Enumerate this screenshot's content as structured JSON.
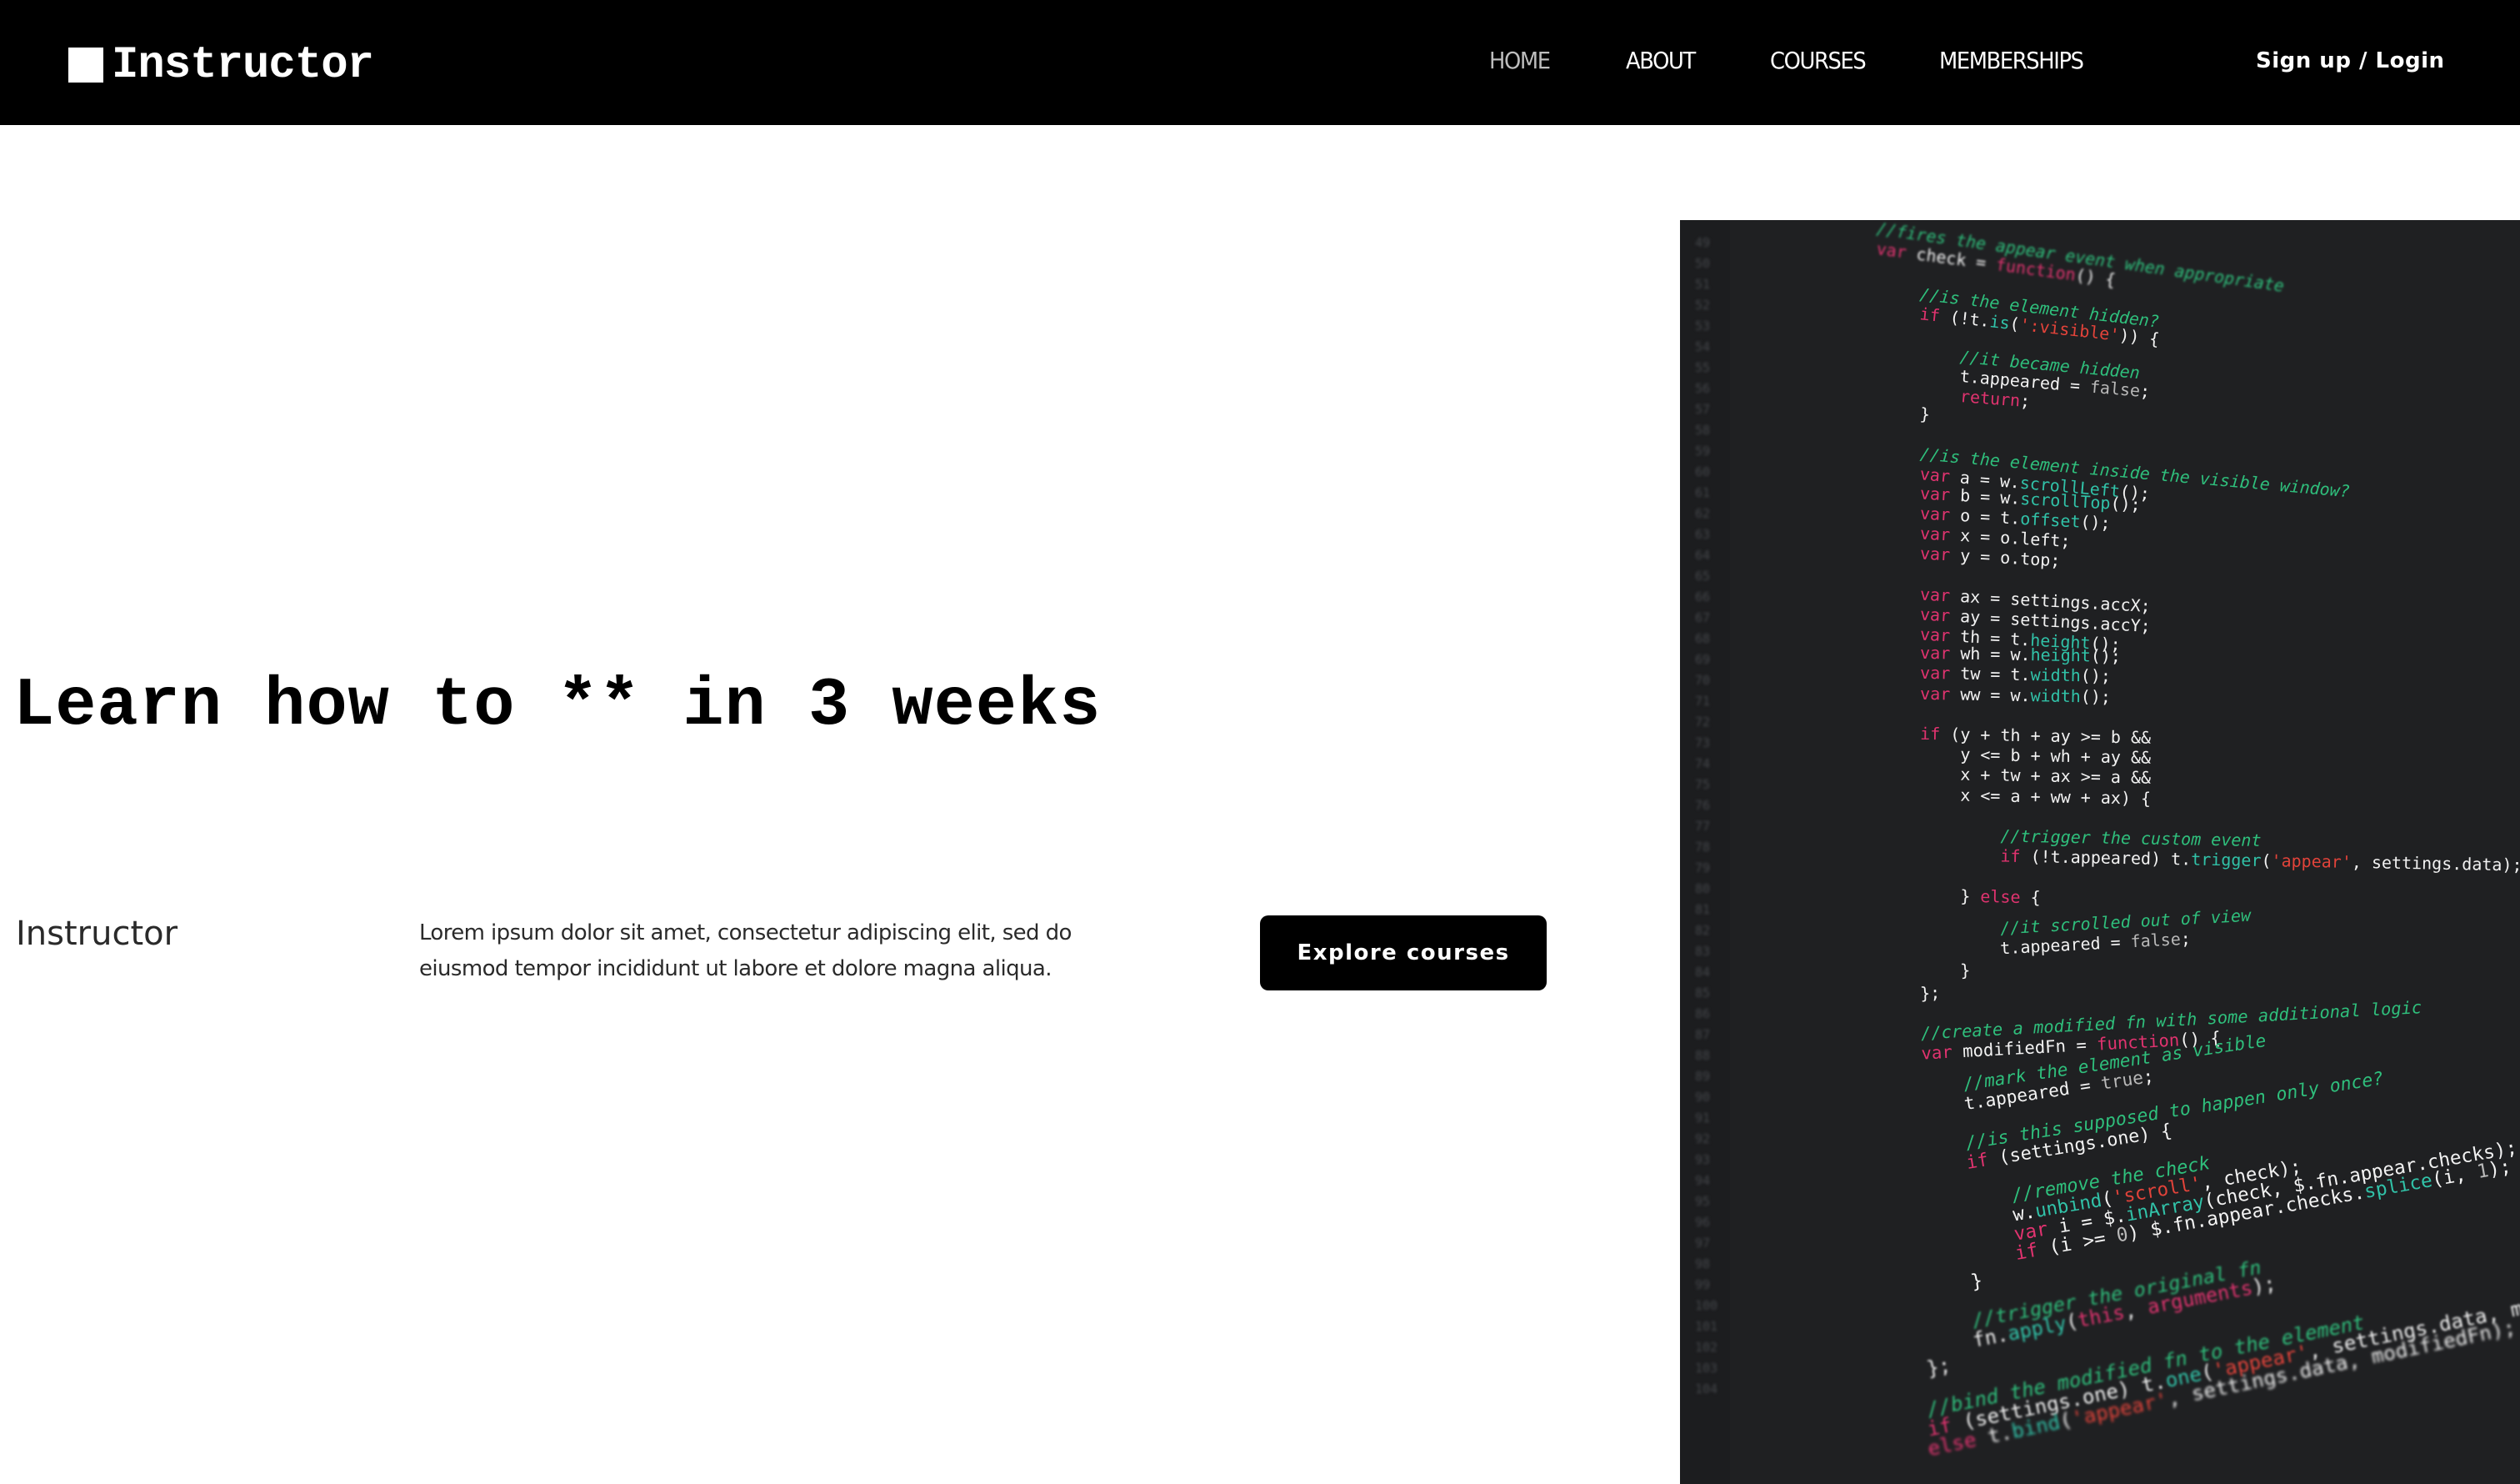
{
  "header": {
    "logo_text": "Instructor",
    "nav": [
      {
        "label": "HOME",
        "active": true
      },
      {
        "label": "ABOUT",
        "active": false
      },
      {
        "label": "COURSES",
        "active": false
      },
      {
        "label": "MEMBERSHIPS",
        "active": false
      }
    ],
    "signup_label": "Sign up / Login"
  },
  "hero": {
    "title": "Learn how to ** in 3 weeks",
    "brand_label": "Instructor",
    "description": "Lorem ipsum dolor sit amet, consectetur adipiscing elit, sed do eiusmod tempor incididunt ut labore et dolore magna aliqua.",
    "cta_label": "Explore courses"
  },
  "code_image": {
    "gutter_numbers": [
      "49",
      "50",
      "51",
      "52",
      "53",
      "54",
      "55",
      "56",
      "57",
      "58",
      "59",
      "60",
      "61",
      "62",
      "63",
      "64",
      "65",
      "66",
      "67",
      "68",
      "69",
      "70",
      "71",
      "72",
      "73",
      "74",
      "75",
      "76",
      "77",
      "78",
      "79",
      "80",
      "81",
      "82",
      "83",
      "84",
      "85",
      "86",
      "87",
      "88",
      "89",
      "90",
      "91",
      "92",
      "93",
      "94",
      "95",
      "96",
      "97",
      "98",
      "99",
      "100",
      "101",
      "102",
      "103",
      "104"
    ],
    "lines": [
      [
        {
          "t": "//fires the appear event when appropriate",
          "c": "cm"
        }
      ],
      [
        {
          "t": "var ",
          "c": "kw"
        },
        {
          "t": "check = "
        },
        {
          "t": "function",
          "c": "kw"
        },
        {
          "t": "() {"
        }
      ],
      [],
      [
        {
          "t": "    //is the element hidden?",
          "c": "cm"
        }
      ],
      [
        {
          "t": "    if ",
          "c": "kw"
        },
        {
          "t": "(!t."
        },
        {
          "t": "is",
          "c": "fn"
        },
        {
          "t": "("
        },
        {
          "t": "':visible'",
          "c": "str"
        },
        {
          "t": ")) {"
        }
      ],
      [],
      [
        {
          "t": "        //it became hidden",
          "c": "cm"
        }
      ],
      [
        {
          "t": "        t.appeared = "
        },
        {
          "t": "false",
          "c": "lit"
        },
        {
          "t": ";"
        }
      ],
      [
        {
          "t": "        return",
          "c": "kw"
        },
        {
          "t": ";"
        }
      ],
      [
        {
          "t": "    }"
        }
      ],
      [],
      [
        {
          "t": "    //is the element inside the visible window?",
          "c": "cm"
        }
      ],
      [
        {
          "t": "    var ",
          "c": "kw"
        },
        {
          "t": "a = w."
        },
        {
          "t": "scrollLeft",
          "c": "fn"
        },
        {
          "t": "();"
        }
      ],
      [
        {
          "t": "    var ",
          "c": "kw"
        },
        {
          "t": "b = w."
        },
        {
          "t": "scrollTop",
          "c": "fn"
        },
        {
          "t": "();"
        }
      ],
      [
        {
          "t": "    var ",
          "c": "kw"
        },
        {
          "t": "o = t."
        },
        {
          "t": "offset",
          "c": "fn"
        },
        {
          "t": "();"
        }
      ],
      [
        {
          "t": "    var ",
          "c": "kw"
        },
        {
          "t": "x = o.left;"
        }
      ],
      [
        {
          "t": "    var ",
          "c": "kw"
        },
        {
          "t": "y = o.top;"
        }
      ],
      [],
      [
        {
          "t": "    var ",
          "c": "kw"
        },
        {
          "t": "ax = settings.accX;"
        }
      ],
      [
        {
          "t": "    var ",
          "c": "kw"
        },
        {
          "t": "ay = settings.accY;"
        }
      ],
      [
        {
          "t": "    var ",
          "c": "kw"
        },
        {
          "t": "th = t."
        },
        {
          "t": "height",
          "c": "fn"
        },
        {
          "t": "();"
        }
      ],
      [
        {
          "t": "    var ",
          "c": "kw"
        },
        {
          "t": "wh = w."
        },
        {
          "t": "height",
          "c": "fn"
        },
        {
          "t": "();"
        }
      ],
      [
        {
          "t": "    var ",
          "c": "kw"
        },
        {
          "t": "tw = t."
        },
        {
          "t": "width",
          "c": "fn"
        },
        {
          "t": "();"
        }
      ],
      [
        {
          "t": "    var ",
          "c": "kw"
        },
        {
          "t": "ww = w."
        },
        {
          "t": "width",
          "c": "fn"
        },
        {
          "t": "();"
        }
      ],
      [],
      [
        {
          "t": "    if ",
          "c": "kw"
        },
        {
          "t": "(y + th + ay >= b &&"
        }
      ],
      [
        {
          "t": "        y <= b + wh + ay &&"
        }
      ],
      [
        {
          "t": "        x + tw + ax >= a &&"
        }
      ],
      [
        {
          "t": "        x <= a + ww + ax) {"
        }
      ],
      [],
      [
        {
          "t": "            //trigger the custom event",
          "c": "cm"
        }
      ],
      [
        {
          "t": "            if ",
          "c": "kw"
        },
        {
          "t": "(!t.appeared) t."
        },
        {
          "t": "trigger",
          "c": "fn"
        },
        {
          "t": "("
        },
        {
          "t": "'appear'",
          "c": "str"
        },
        {
          "t": ", settings.data);"
        }
      ],
      [],
      [
        {
          "t": "        } "
        },
        {
          "t": "else",
          "c": "kw"
        },
        {
          "t": " {"
        }
      ],
      [],
      [
        {
          "t": "            //it scrolled out of view",
          "c": "cm"
        }
      ],
      [
        {
          "t": "            t.appeared = "
        },
        {
          "t": "false",
          "c": "lit"
        },
        {
          "t": ";"
        }
      ],
      [
        {
          "t": "        }"
        }
      ],
      [
        {
          "t": "    };"
        }
      ],
      [],
      [
        {
          "t": "    //create a modified fn with some additional logic",
          "c": "cm"
        }
      ],
      [
        {
          "t": "    var ",
          "c": "kw"
        },
        {
          "t": "modifiedFn = "
        },
        {
          "t": "function",
          "c": "kw"
        },
        {
          "t": "() {"
        }
      ],
      [],
      [
        {
          "t": "        //mark the element as visible",
          "c": "cm"
        }
      ],
      [
        {
          "t": "        t.appeared = "
        },
        {
          "t": "true",
          "c": "lit"
        },
        {
          "t": ";"
        }
      ],
      [],
      [
        {
          "t": "        //is this supposed to happen only once?",
          "c": "cm"
        }
      ],
      [
        {
          "t": "        if ",
          "c": "kw"
        },
        {
          "t": "(settings.one) {"
        }
      ],
      [],
      [
        {
          "t": "            //remove the check",
          "c": "cm"
        }
      ],
      [
        {
          "t": "            w."
        },
        {
          "t": "unbind",
          "c": "fn"
        },
        {
          "t": "("
        },
        {
          "t": "'scroll'",
          "c": "str"
        },
        {
          "t": ", check);"
        }
      ],
      [
        {
          "t": "            var ",
          "c": "kw"
        },
        {
          "t": "i = $."
        },
        {
          "t": "inArray",
          "c": "fn"
        },
        {
          "t": "(check, $.fn.appear.checks);"
        }
      ],
      [
        {
          "t": "            if ",
          "c": "kw"
        },
        {
          "t": "(i >= "
        },
        {
          "t": "0",
          "c": "lit"
        },
        {
          "t": ") $.fn.appear.checks."
        },
        {
          "t": "splice",
          "c": "fn"
        },
        {
          "t": "(i, "
        },
        {
          "t": "1",
          "c": "lit"
        },
        {
          "t": ");"
        }
      ],
      [
        {
          "t": "        }"
        }
      ],
      [],
      [
        {
          "t": "        //trigger the original fn",
          "c": "cm"
        }
      ],
      [
        {
          "t": "        fn."
        },
        {
          "t": "apply",
          "c": "fn"
        },
        {
          "t": "("
        },
        {
          "t": "this",
          "c": "kw"
        },
        {
          "t": ", "
        },
        {
          "t": "arguments",
          "c": "kw"
        },
        {
          "t": ");"
        }
      ],
      [
        {
          "t": "    };"
        }
      ],
      [],
      [
        {
          "t": "    //bind the modified fn to the element",
          "c": "cm"
        }
      ],
      [
        {
          "t": "    if ",
          "c": "kw"
        },
        {
          "t": "(settings.one) t."
        },
        {
          "t": "one",
          "c": "fn"
        },
        {
          "t": "("
        },
        {
          "t": "'appear'",
          "c": "str"
        },
        {
          "t": ", settings.data, modifiedFn);"
        }
      ],
      [
        {
          "t": "    else ",
          "c": "kw"
        },
        {
          "t": "t."
        },
        {
          "t": "bind",
          "c": "fn"
        },
        {
          "t": "("
        },
        {
          "t": "'appear'",
          "c": "str"
        },
        {
          "t": ", settings.data, modifiedFn);"
        }
      ]
    ]
  }
}
